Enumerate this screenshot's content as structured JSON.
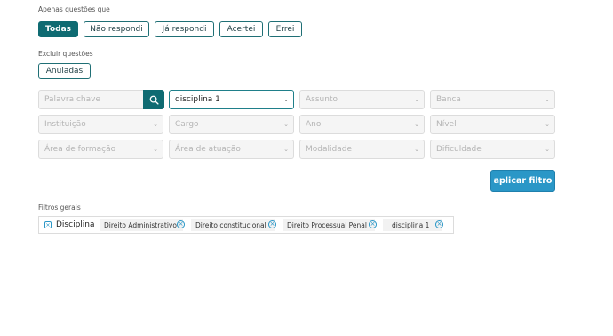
{
  "only_questions": {
    "label": "Apenas questões que",
    "options": [
      "Todas",
      "Não respondi",
      "Já respondi",
      "Acertei",
      "Errei"
    ],
    "selected": "Todas"
  },
  "exclude": {
    "label": "Excluir questões",
    "options": [
      "Anuladas"
    ]
  },
  "search": {
    "placeholder": "Palavra chave"
  },
  "selects": {
    "disciplina": {
      "value": "disciplina 1"
    },
    "assunto": {
      "placeholder": "Assunto"
    },
    "banca": {
      "placeholder": "Banca"
    },
    "instituicao": {
      "placeholder": "Instituição"
    },
    "cargo": {
      "placeholder": "Cargo"
    },
    "ano": {
      "placeholder": "Ano"
    },
    "nivel": {
      "placeholder": "Nível"
    },
    "area_formacao": {
      "placeholder": "Área de formação"
    },
    "area_atuacao": {
      "placeholder": "Área de atuação"
    },
    "modalidade": {
      "placeholder": "Modalidade"
    },
    "dificuldade": {
      "placeholder": "Dificuldade"
    }
  },
  "apply_button": {
    "label": "aplicar filtro"
  },
  "general_filters": {
    "label": "Filtros gerais",
    "group_label": "Disciplina",
    "chips": [
      "Direito Administrativo",
      "Direito constitucional",
      "Direito Processual Penal",
      "disciplina 1"
    ]
  },
  "colors": {
    "primary": "#0f6b72",
    "apply": "#2a97c7"
  }
}
